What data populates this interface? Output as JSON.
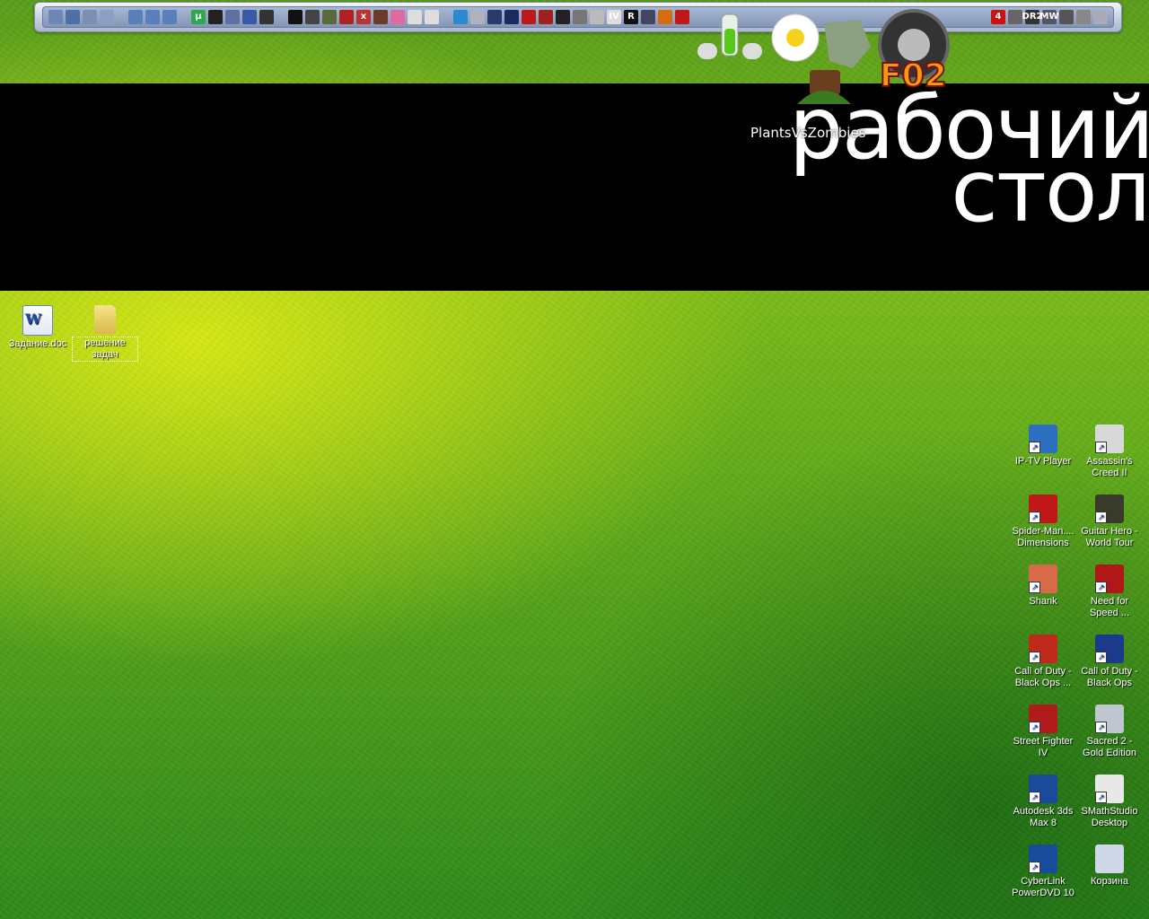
{
  "banner": {
    "title_line1": "рабочий",
    "title_line2": "стол",
    "pvz_label": "PlantsVsZombies"
  },
  "dock": {
    "tools": [
      {
        "icon": "drive-icon",
        "color": "#6d86b3"
      },
      {
        "icon": "network-icon",
        "color": "#4e6fa7"
      },
      {
        "icon": "folder-icon",
        "color": "#7a8fb4"
      },
      {
        "icon": "document-icon",
        "color": "#8ba0c4"
      },
      {
        "icon": "separator"
      },
      {
        "icon": "ie-icon",
        "color": "#5a7fbd"
      },
      {
        "icon": "ie-icon",
        "color": "#5a7fbd"
      },
      {
        "icon": "ie-icon",
        "color": "#5a7fbd"
      },
      {
        "icon": "separator"
      },
      {
        "icon": "utorrent-icon",
        "color": "#2da84a",
        "text": "μ"
      },
      {
        "icon": "display-icon",
        "color": "#222"
      },
      {
        "icon": "joystick-icon",
        "color": "#6070a0"
      },
      {
        "icon": "monitor-icon",
        "color": "#3a58a8"
      },
      {
        "icon": "steam-icon",
        "color": "#333"
      },
      {
        "icon": "separator"
      },
      {
        "icon": "penguin-icon",
        "color": "#111"
      },
      {
        "icon": "car-icon",
        "color": "#444"
      },
      {
        "icon": "plane-icon",
        "color": "#5a6a3a"
      },
      {
        "icon": "bird-icon",
        "color": "#b02020"
      },
      {
        "icon": "zoom-icon",
        "color": "#c03030",
        "text": "x"
      },
      {
        "icon": "bear-icon",
        "color": "#6a3a2a"
      },
      {
        "icon": "pig-icon",
        "color": "#e06aa0"
      },
      {
        "icon": "skull-icon",
        "color": "#ddd"
      },
      {
        "icon": "bulb-icon",
        "color": "#ddd"
      },
      {
        "icon": "separator"
      },
      {
        "icon": "check-icon",
        "color": "#2a8ad0"
      },
      {
        "icon": "crosshair-icon",
        "color": "#b0b0c0"
      },
      {
        "icon": "shield-icon",
        "color": "#2a3a6a"
      },
      {
        "icon": "crest-icon",
        "color": "#1c2a60"
      },
      {
        "icon": "spiderman-icon",
        "color": "#c01818"
      },
      {
        "icon": "fighter-icon",
        "color": "#a02020"
      },
      {
        "icon": "nfs-icon",
        "color": "#222"
      },
      {
        "icon": "triangle-icon",
        "color": "#777"
      },
      {
        "icon": "blade-icon",
        "color": "#bbb"
      },
      {
        "icon": "gta4-icon",
        "color": "#ddd",
        "text": "IV"
      },
      {
        "icon": "rockstar-icon",
        "color": "#111",
        "text": "R"
      },
      {
        "icon": "soldier-icon",
        "color": "#446"
      },
      {
        "icon": "mask-icon",
        "color": "#d86a10"
      },
      {
        "icon": "undo-icon",
        "color": "#c01818"
      }
    ],
    "tail_tools": [
      {
        "icon": "left4dead-icon",
        "color": "#cc1111",
        "text": "4"
      },
      {
        "icon": "helmet-icon",
        "color": "#666"
      },
      {
        "icon": "dr2-icon",
        "color": "#333",
        "text": "DR2"
      },
      {
        "icon": "mw-icon",
        "color": "#556",
        "text": "MW"
      },
      {
        "icon": "skull-crossbones-icon",
        "color": "#555"
      },
      {
        "icon": "wrench-icon",
        "color": "#888"
      },
      {
        "icon": "recycle-icon",
        "color": "#aab"
      }
    ]
  },
  "left_icons": [
    {
      "label": "Задание.doc",
      "type": "word",
      "selected": false
    },
    {
      "label": "решение задач",
      "type": "folder",
      "selected": true
    }
  ],
  "right_icons": [
    {
      "label": "IP-TV Player",
      "color": "#2d6fbf"
    },
    {
      "label": "Assassin's Creed II",
      "color": "#d8d8d8"
    },
    {
      "label": "Spider-Man.... Dimensions",
      "color": "#c01818"
    },
    {
      "label": "Guitar Hero - World Tour",
      "color": "#3a3a2a"
    },
    {
      "label": "Shank",
      "color": "#d86a4a"
    },
    {
      "label": "Need for Speed ...",
      "color": "#b01818"
    },
    {
      "label": "Call of Duty - Black Ops ...",
      "color": "#c02a1a"
    },
    {
      "label": "Call of Duty - Black Ops",
      "color": "#1c3a8c"
    },
    {
      "label": "Street Fighter IV",
      "color": "#b01a1a"
    },
    {
      "label": "Sacred 2 - Gold Edition",
      "color": "#c0c6d0"
    },
    {
      "label": "Autodesk 3ds Max 8",
      "color": "#1a4a9a"
    },
    {
      "label": "SMathStudio Desktop",
      "color": "#e8e8e8"
    },
    {
      "label": "CyberLink PowerDVD 10",
      "color": "#1a4a9a"
    },
    {
      "label": "Корзина",
      "color": "#cfd8e8"
    }
  ]
}
